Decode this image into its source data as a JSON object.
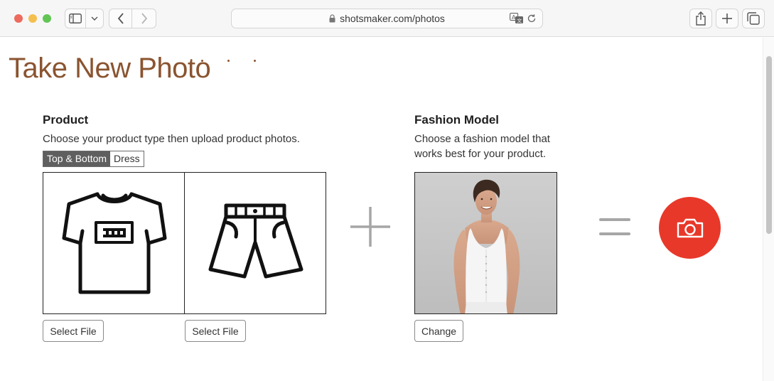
{
  "browser": {
    "url": "shotsmaker.com/photos",
    "icons": [
      "sidebar-icon",
      "chevron-down-icon",
      "back-arrow-icon",
      "forward-arrow-icon",
      "lock-icon",
      "translate-icon",
      "reload-icon",
      "share-icon",
      "plus-icon",
      "tabs-icon"
    ]
  },
  "page": {
    "title": "Take New Photo",
    "title_color": "#8a5430"
  },
  "product": {
    "heading": "Product",
    "description": "Choose your product type then upload product photos.",
    "types": [
      "Top & Bottom",
      "Dress"
    ],
    "selected_type": "Top & Bottom",
    "slots": [
      {
        "icon": "tshirt-icon",
        "button": "Select File"
      },
      {
        "icon": "shorts-icon",
        "button": "Select File"
      }
    ]
  },
  "model": {
    "heading": "Fashion Model",
    "description_line1": "Choose a fashion model that",
    "description_line2": "works best for your product.",
    "button": "Change"
  },
  "operators": {
    "plus": "plus-icon",
    "equals": "equals-icon"
  },
  "capture": {
    "icon": "camera-icon",
    "color": "#e8382a"
  }
}
